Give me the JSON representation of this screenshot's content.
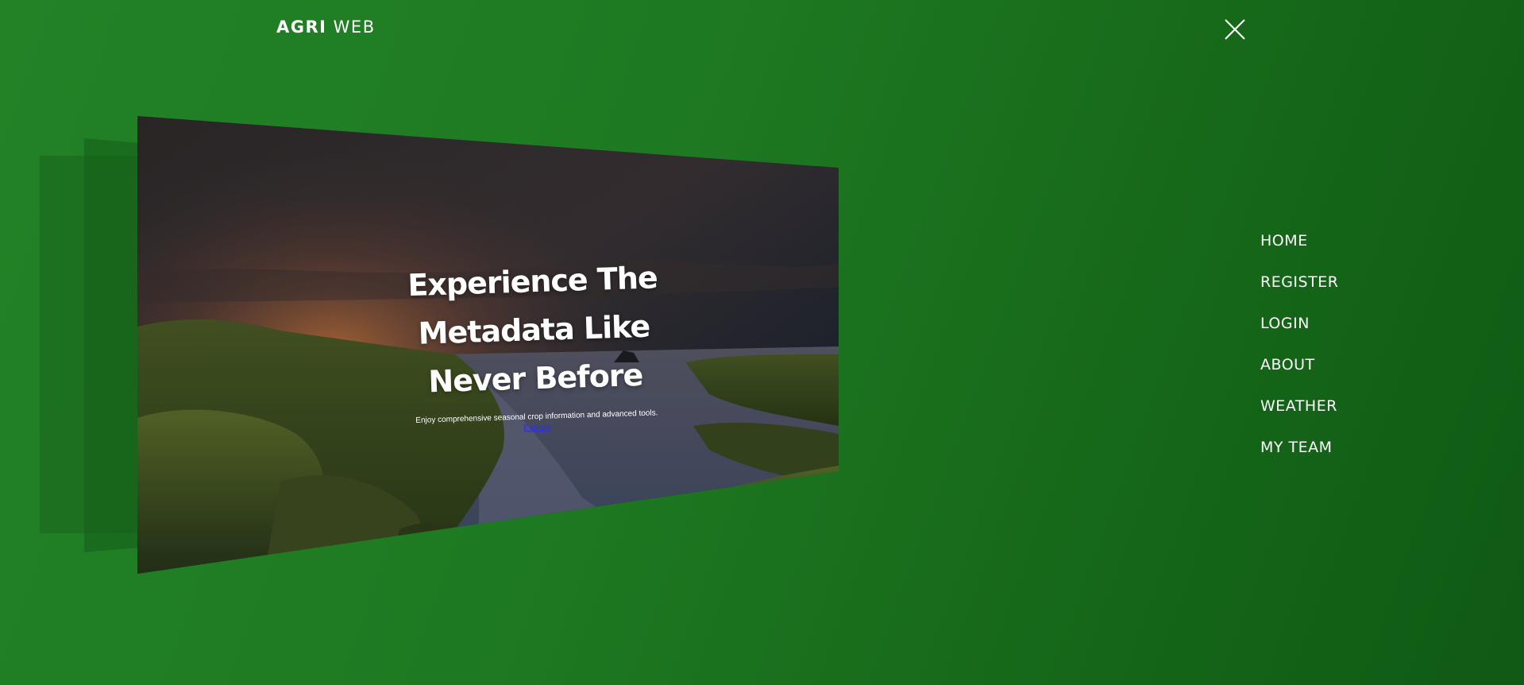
{
  "brand": {
    "name_bold": "AGRI",
    "name_light": "WEB"
  },
  "hero": {
    "title_line1": "Experience The",
    "title_line2": "Metadata Like",
    "title_line3": "Never Before",
    "subtitle": "Enjoy comprehensive seasonal crop information and advanced tools.",
    "link_label": "Explore"
  },
  "nav": {
    "items": [
      {
        "label": "HOME"
      },
      {
        "label": "REGISTER"
      },
      {
        "label": "LOGIN"
      },
      {
        "label": "ABOUT"
      },
      {
        "label": "WEATHER"
      },
      {
        "label": "MY TEAM"
      }
    ]
  },
  "icons": {
    "close": "close-icon"
  },
  "colors": {
    "background": "#1e7a22",
    "text": "#ffffff",
    "link": "#2a2aff"
  }
}
